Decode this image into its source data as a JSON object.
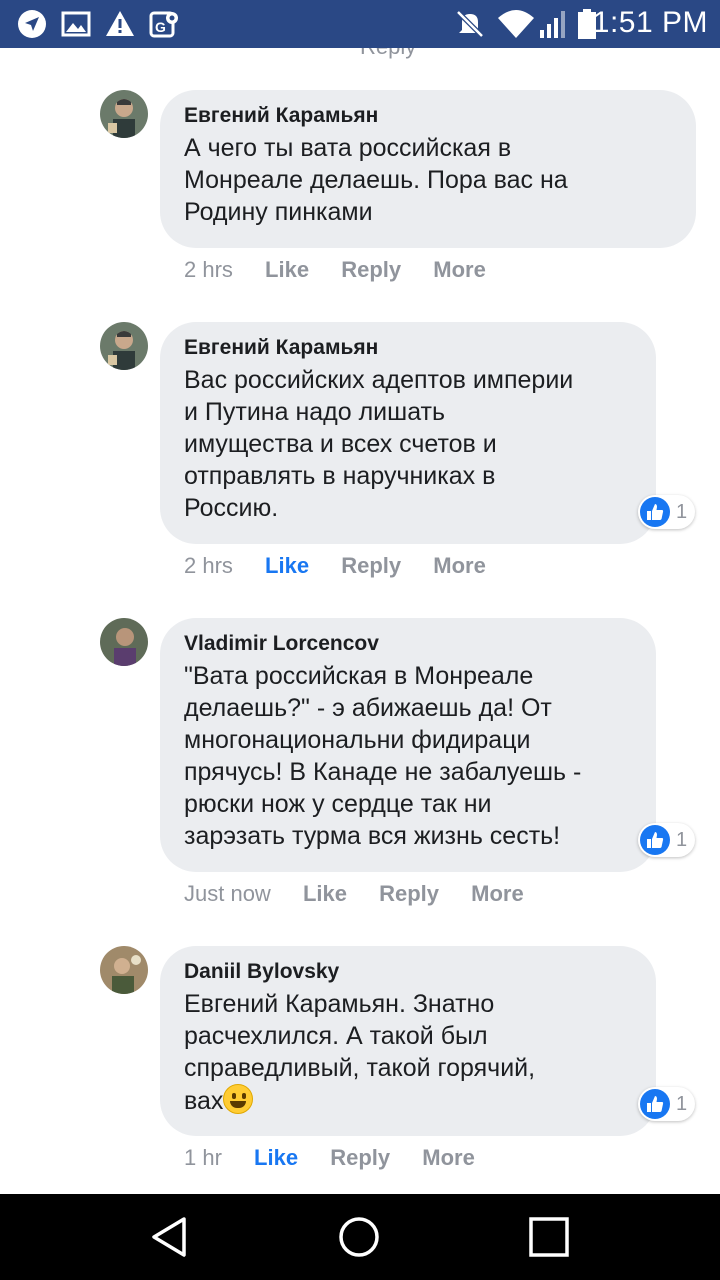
{
  "status_bar": {
    "time": "1:51 PM",
    "icons": [
      "navigation-icon",
      "image-icon",
      "warning-icon",
      "maps-icon",
      "mute-icon",
      "wifi-icon",
      "signal-icon",
      "battery-icon"
    ]
  },
  "feed": {
    "cut_off_text": "Reply",
    "comments": [
      {
        "author": "Евгений Карамьян",
        "text": "А чего ты вата российская в\nМонреале делаешь. Пора вас на\nРодину пинками",
        "time": "2 hrs",
        "like": "Like",
        "reply": "Reply",
        "more": "More",
        "liked": false,
        "reactions": null
      },
      {
        "author": "Евгений Карамьян",
        "text": "Вас российских адептов империи\nи Путина надо лишать\nимущества и всех счетов и\nотправлять в наручниках в\nРоссию.",
        "time": "2 hrs",
        "like": "Like",
        "reply": "Reply",
        "more": "More",
        "liked": true,
        "reactions": "1"
      },
      {
        "author": "Vladimir Lorcencov",
        "text": "\"Вата российская в Монреале\nделаешь?\" - э абижаешь да! От\nмногонациональни фидираци\nпрячусь! В Канаде не забалуешь -\nрюски нож у сердце так ни\nзарэзать турма вся жизнь сесть!",
        "time": "Just now",
        "like": "Like",
        "reply": "Reply",
        "more": "More",
        "liked": false,
        "reactions": "1"
      },
      {
        "author": "Daniil Bylovsky",
        "text": "Евгений Карамьян. Знатно\nрасчехлился. А такой был\nсправедливый, такой горячий,\nвах",
        "time": "1 hr",
        "like": "Like",
        "reply": "Reply",
        "more": "More",
        "liked": true,
        "reactions": "1"
      }
    ]
  },
  "colors": {
    "status_bar": "#2a4885",
    "bubble": "#ebedf0",
    "liked": "#1877f2",
    "meta": "#90949c"
  }
}
